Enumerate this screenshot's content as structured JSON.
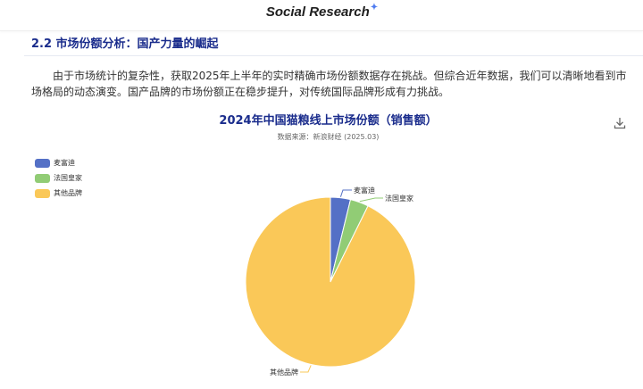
{
  "header": {
    "brand": "Social Research",
    "sparkle": "✦"
  },
  "section": {
    "title": "2.2 市场份额分析：国产力量的崛起",
    "paragraph": "由于市场统计的复杂性，获取2025年上半年的实时精确市场份额数据存在挑战。但综合近年数据，我们可以清晰地看到市场格局的动态演变。国产品牌的市场份额正在稳步提升，对传统国际品牌形成有力挑战。"
  },
  "toolbar": {
    "download_icon": "download-icon"
  },
  "chart_data": {
    "type": "pie",
    "title": "2024年中国猫粮线上市场份额（销售额）",
    "subtitle": "数据来源：新浪财经 (2025.03)",
    "legend_position": "top-left",
    "slices": [
      {
        "name": "麦富迪",
        "value": 3.8,
        "color": "#5470c6"
      },
      {
        "name": "法国皇家",
        "value": 3.5,
        "color": "#91cc75"
      },
      {
        "name": "其他品牌",
        "value": 92.7,
        "color": "#fac858"
      }
    ]
  }
}
